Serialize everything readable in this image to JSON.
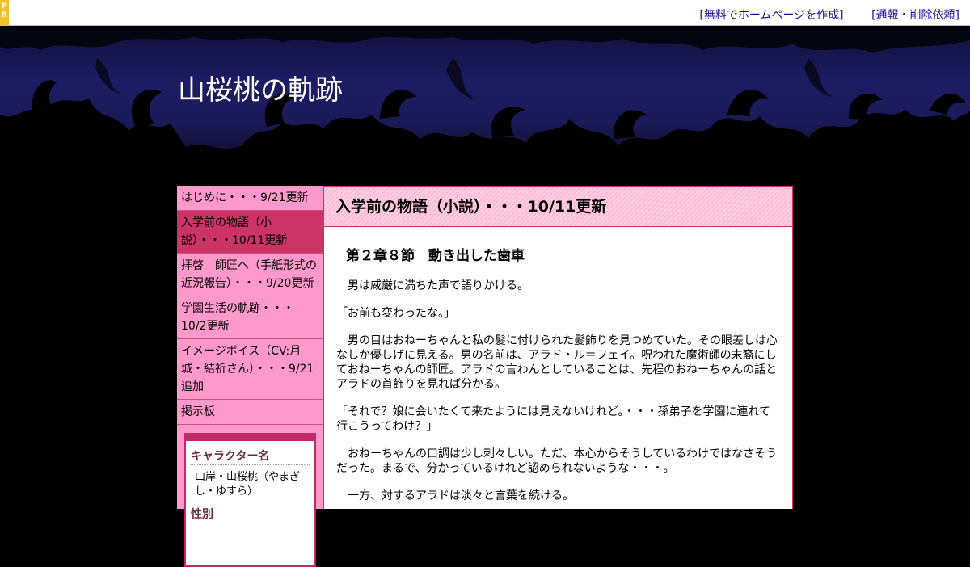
{
  "topbar": {
    "pr_letters": [
      "P",
      "R"
    ],
    "links": [
      "[無料でホームページを作成]",
      "[通報・削除依頼]"
    ]
  },
  "site": {
    "title": "山桜桃の軌跡"
  },
  "sidebar": {
    "menu": [
      {
        "label": "はじめに・・・9/21更新",
        "active": false
      },
      {
        "label": "入学前の物語（小説）・・・10/11更新",
        "active": true
      },
      {
        "label": "拝啓　師匠へ（手紙形式の近況報告）・・・9/20更新",
        "active": false
      },
      {
        "label": "学園生活の軌跡・・・10/2更新",
        "active": false
      },
      {
        "label": "イメージボイス（CV:月城・結祈さん）・・・9/21追加",
        "active": false
      },
      {
        "label": "掲示板",
        "active": false
      }
    ],
    "profile": [
      {
        "term": "キャラクター名",
        "value": "山岸・山桜桃（やまぎし・ゆすら）"
      },
      {
        "term": "性別",
        "value": ""
      }
    ]
  },
  "main": {
    "page_title": "入学前の物語（小説）・・・10/11更新",
    "chapter_title": "第２章８節　動き出した歯車",
    "paragraphs": [
      "　男は威厳に満ちた声で語りかける。",
      "「お前も変わったな。」",
      "　男の目はおねーちゃんと私の髪に付けられた髪飾りを見つめていた。その眼差しは心なしか優しげに見える。男の名前は、アラド・ル＝フェイ。呪われた魔術師の末裔にしておねーちゃんの師匠。アラドの言わんとしていることは、先程のおねーちゃんの話とアラドの首飾りを見れば分かる。",
      "「それで？娘に会いたくて来たようには見えないけれど。・・・孫弟子を学園に連れて行こうってわけ？」",
      "　おねーちゃんの口調は少し刺々しい。ただ、本心からそうしているわけではなさそうだった。まるで、分かっているけれど認められないような・・・。",
      "　一方、対するアラドは淡々と言葉を続ける。"
    ]
  },
  "colors": {
    "sidebar_bg": "#ff99cc",
    "sidebar_active": "#cc3366",
    "accent": "#cc3366",
    "header_sky": "#1c1c64",
    "link": "#1a0dab",
    "pr_tab": "#f2c12e"
  }
}
